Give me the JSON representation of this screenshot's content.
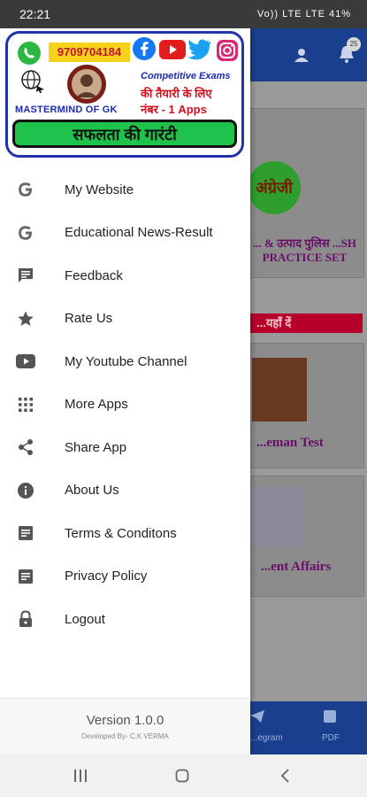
{
  "status_bar": {
    "time": "22:21",
    "right_icons": "Vo)) LTE LTE 41%"
  },
  "background_app": {
    "badge": "25",
    "card1_badge": "अंग्रेजी",
    "card1_text": "... & उत्पाद पुलिस ...SH PRACTICE SET",
    "red_bar": "...यहाँ दें",
    "card2_text": "...eman Test",
    "card3_text": "...ent Affairs",
    "bottom_nav": [
      {
        "label": "...egram"
      },
      {
        "label": "PDF"
      }
    ]
  },
  "banner": {
    "phone": "9709704184",
    "brand": "MASTERMIND OF GK",
    "competitive": "Competitive Exams",
    "hindi_line1": "की तैयारी के लिए",
    "hindi_line2": "नंबर - 1 Apps",
    "slogan": "सफलता की गारंटी"
  },
  "menu": [
    {
      "label": "My Website",
      "icon": "google-icon"
    },
    {
      "label": "Educational News-Result",
      "icon": "google-icon"
    },
    {
      "label": "Feedback",
      "icon": "feedback-icon"
    },
    {
      "label": "Rate Us",
      "icon": "star-icon"
    },
    {
      "label": "My Youtube Channel",
      "icon": "youtube-icon"
    },
    {
      "label": "More Apps",
      "icon": "apps-grid-icon"
    },
    {
      "label": "Share App",
      "icon": "share-icon"
    },
    {
      "label": "About Us",
      "icon": "info-icon"
    },
    {
      "label": "Terms & Conditons",
      "icon": "document-icon"
    },
    {
      "label": "Privacy Policy",
      "icon": "document-icon"
    },
    {
      "label": "Logout",
      "icon": "lock-icon"
    }
  ],
  "footer": {
    "version": "Version 1.0.0",
    "developer": "Developed By- C.K VERMA"
  }
}
